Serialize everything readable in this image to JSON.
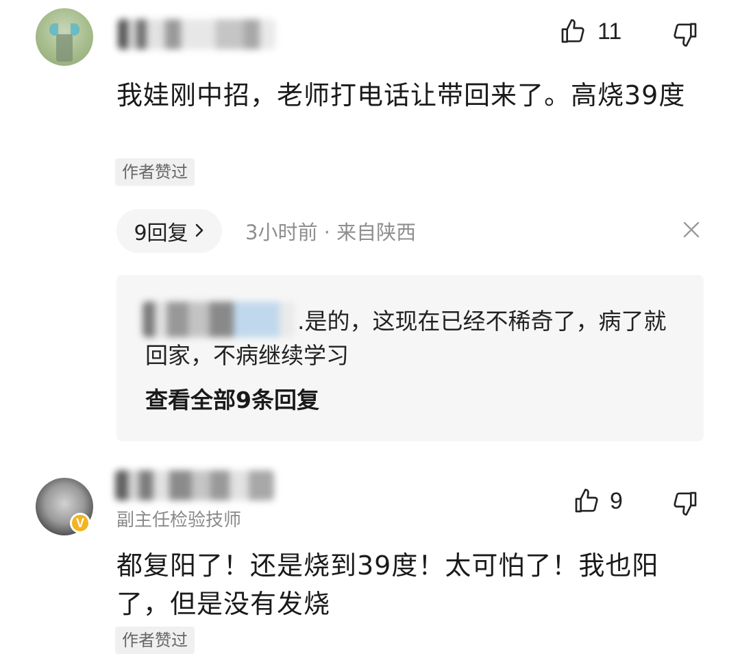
{
  "comments": [
    {
      "like_count": "11",
      "text": "我娃刚中招，老师打电话让带回来了。高烧39度",
      "tag": "作者赞过",
      "replies_label": "9回复",
      "meta": "3小时前 · 来自陕西",
      "reply_preview": {
        "text": ".是的，这现在已经不稀奇了，病了就回家，不病继续学习",
        "view_all": "查看全部9条回复"
      }
    },
    {
      "subtitle": "副主任检验技师",
      "verified_badge": "V",
      "like_count": "9",
      "text": "都复阳了！还是烧到39度！太可怕了！我也阳了，但是没有发烧",
      "tag": "作者赞过"
    }
  ],
  "icons": {
    "like": "thumbs-up-icon",
    "dislike": "thumbs-down-icon",
    "close": "close-icon",
    "chevron": "chevron-right-icon"
  },
  "colors": {
    "text": "#1a1a1a",
    "muted": "#8e8e8e",
    "tag_bg": "#f0f0f0",
    "reply_bg": "#f6f6f6",
    "verified": "#f2b420"
  }
}
